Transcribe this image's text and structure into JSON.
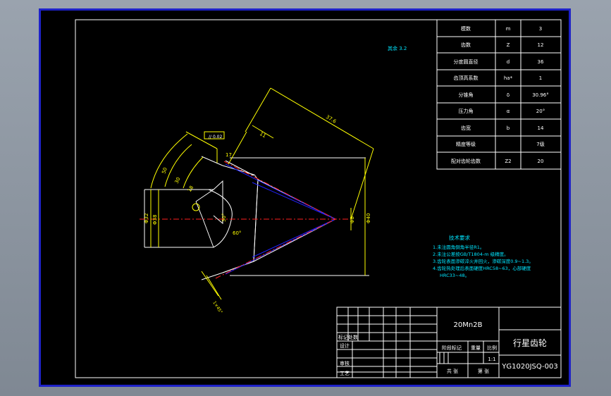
{
  "title_block": {
    "material": "20Mn2B",
    "part_name": "行星齿轮",
    "drawing_no": "YG1020JSQ-003",
    "scale": "1:1",
    "labels": {
      "mark_region": "标记处数",
      "design": "设计",
      "review": "审核",
      "process": "工艺",
      "stage_mark": "阶段标记",
      "weight": "重量",
      "scale": "比例",
      "total_sheets": "共 张",
      "sheet_no": "第 张"
    }
  },
  "param_table": [
    {
      "name": "模数",
      "symbol": "m",
      "value": "3"
    },
    {
      "name": "齿数",
      "symbol": "Z",
      "value": "12"
    },
    {
      "name": "分度圆直径",
      "symbol": "d",
      "value": "36"
    },
    {
      "name": "齿顶高系数",
      "symbol": "ha*",
      "value": "1"
    },
    {
      "name": "分锥角",
      "symbol": "δ",
      "value": "30.96°"
    },
    {
      "name": "压力角",
      "symbol": "α",
      "value": "20°"
    },
    {
      "name": "齿宽",
      "symbol": "b",
      "value": "14"
    },
    {
      "name": "精度等级",
      "symbol": "",
      "value": "7级"
    },
    {
      "name": "配对齿轮齿数",
      "symbol": "Z2",
      "value": "20"
    }
  ],
  "roughness_note": "其余 3.2",
  "tech_requirements": {
    "title": "技术要求",
    "items": [
      "1.未注圆角倒角半径R1。",
      "2.未注公差按GB/T1804-m 级精度。",
      "3.齿轮表面渗碳淬火并回火，渗碳深度0.9~1.3。",
      "4.齿轮热处理后表面硬度HRC58~63，心部硬度",
      "HRC33~48。"
    ]
  },
  "dimensions": {
    "d_cone": "37.6",
    "d1": "11",
    "d2": "17",
    "d_arc1": "50",
    "d_arc2": "30",
    "d_arc3": "18",
    "d_left": "Φ32",
    "d_left2": "Φ38",
    "d_right": "Φ8",
    "d_right2": "Φ40",
    "angle1": "30°",
    "angle2": "60°",
    "chamfer": "1×45°",
    "tol_box": "// 0.02"
  },
  "colors": {
    "outline": "#ffffff",
    "dimension": "#ffff00",
    "hidden": "#2020ff",
    "center": "#ff2020",
    "note": "#00e5ff",
    "border": "#1e22c8"
  }
}
